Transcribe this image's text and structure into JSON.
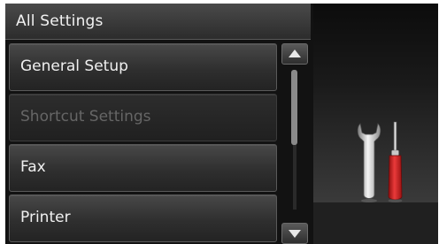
{
  "header": {
    "title": "All Settings"
  },
  "menu": {
    "items": [
      {
        "label": "General Setup",
        "enabled": true
      },
      {
        "label": "Shortcut Settings",
        "enabled": false
      },
      {
        "label": "Fax",
        "enabled": true
      },
      {
        "label": "Printer",
        "enabled": true
      }
    ]
  },
  "scrollbar": {
    "up_icon": "triangle-up",
    "down_icon": "triangle-down"
  },
  "illustration": {
    "icon": "wrench-and-screwdriver",
    "accent": "#d42020"
  }
}
